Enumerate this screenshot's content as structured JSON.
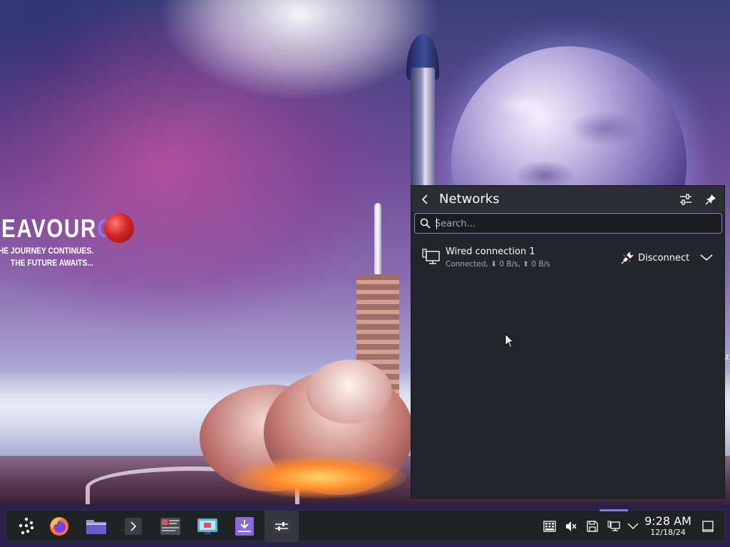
{
  "wallpaper": {
    "logo_title": "EAVOUR",
    "logo_title_accent": "OS",
    "tagline_line1": "S, THE JOURNEY CONTINUES.",
    "tagline_line2": "THE FUTURE AWAITS...",
    "edge_text_1": "st",
    "edge_text_2": "t"
  },
  "popup": {
    "title": "Networks",
    "back_icon": "chevron-left-icon",
    "configure_icon": "configure-sliders-icon",
    "pin_icon": "pin-icon",
    "search": {
      "placeholder": "Search...",
      "value": ""
    },
    "connections": [
      {
        "name": "Wired connection 1",
        "status": "Connected, ⬇ 0 B/s, ⬆ 0 B/s",
        "icon": "wired-network-icon",
        "action_label": "Disconnect",
        "action_icon": "disconnect-plug-icon",
        "expand_icon": "chevron-down-icon"
      }
    ]
  },
  "taskbar": {
    "launchers": [
      {
        "name": "application-launcher",
        "icon": "endeavouros-launcher-icon"
      },
      {
        "name": "firefox",
        "icon": "firefox-icon"
      },
      {
        "name": "file-manager",
        "icon": "folder-icon"
      },
      {
        "name": "terminal",
        "icon": "terminal-icon"
      },
      {
        "name": "system-monitor",
        "icon": "system-monitor-icon"
      },
      {
        "name": "display-settings",
        "icon": "display-settings-icon"
      },
      {
        "name": "software-updater",
        "icon": "download-update-icon"
      },
      {
        "name": "system-settings",
        "icon": "settings-sliders-icon",
        "active": true
      }
    ],
    "tray": [
      {
        "name": "keyboard-layout",
        "icon": "keyboard-icon"
      },
      {
        "name": "volume",
        "icon": "speaker-muted-icon"
      },
      {
        "name": "disks",
        "icon": "disk-icon"
      },
      {
        "name": "network",
        "icon": "wired-network-icon",
        "active": true
      },
      {
        "name": "show-hidden",
        "icon": "chevron-down-icon"
      }
    ],
    "clock": {
      "time": "9:28 AM",
      "date": "12/18/24"
    },
    "show_desktop_icon": "show-desktop-icon"
  },
  "colors": {
    "panel_bg": "#23272b",
    "taskbar_bg": "#202326",
    "accent": "#8f7ed0",
    "text": "#fcfcfc",
    "text_dim": "#a1a9b1"
  }
}
